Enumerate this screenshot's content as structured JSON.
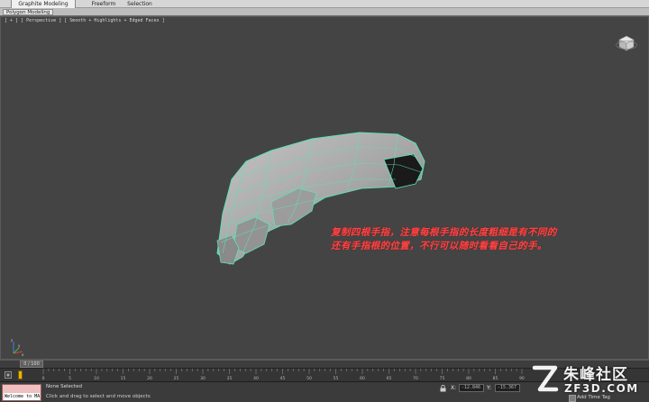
{
  "ribbon": {
    "tabs": [
      {
        "label": "Graphite Modeling Tools",
        "active": true
      },
      {
        "label": "Freeform",
        "active": false
      },
      {
        "label": "Selection",
        "active": false
      }
    ],
    "panel_label": "Polygon Modeling"
  },
  "viewport": {
    "label": "[ + ] [ Perspective ] [ Smooth + Highlights + Edged Faces ]",
    "annotation": [
      "复制四根手指，注意每根手指的长度粗细是有不同的",
      "还有手指根的位置，不行可以随时看看自己的手。"
    ],
    "viewcube_icon": "viewcube-icon",
    "axis_labels": {
      "x": "x",
      "y": "y",
      "z": "z"
    }
  },
  "timeline": {
    "frame_indicator": "0 / 100",
    "ruler_ticks": [
      "0",
      "5",
      "10",
      "15",
      "20",
      "25",
      "30",
      "35",
      "40",
      "45",
      "50",
      "55",
      "60",
      "65",
      "70",
      "75",
      "80",
      "85",
      "90"
    ]
  },
  "status_bar": {
    "listener_text": "Welcome to MAX",
    "selection_status": "None Selected",
    "prompt": "Click and drag to select and move objects",
    "coords": [
      {
        "label": "X:",
        "value": "-12.846"
      },
      {
        "label": "Y:",
        "value": "-15.367"
      }
    ],
    "add_time_tag": "Add Time Tag"
  },
  "watermark": {
    "title": "朱峰社区",
    "url": "ZF3D.COM"
  },
  "colors": {
    "viewport_bg": "#444444",
    "annotation": "#ff4444",
    "wire": "#5fe0b4",
    "mesh": "#b2b2b2",
    "listener_bg": "#f0bfbf",
    "key_filter": "#e8b400"
  }
}
